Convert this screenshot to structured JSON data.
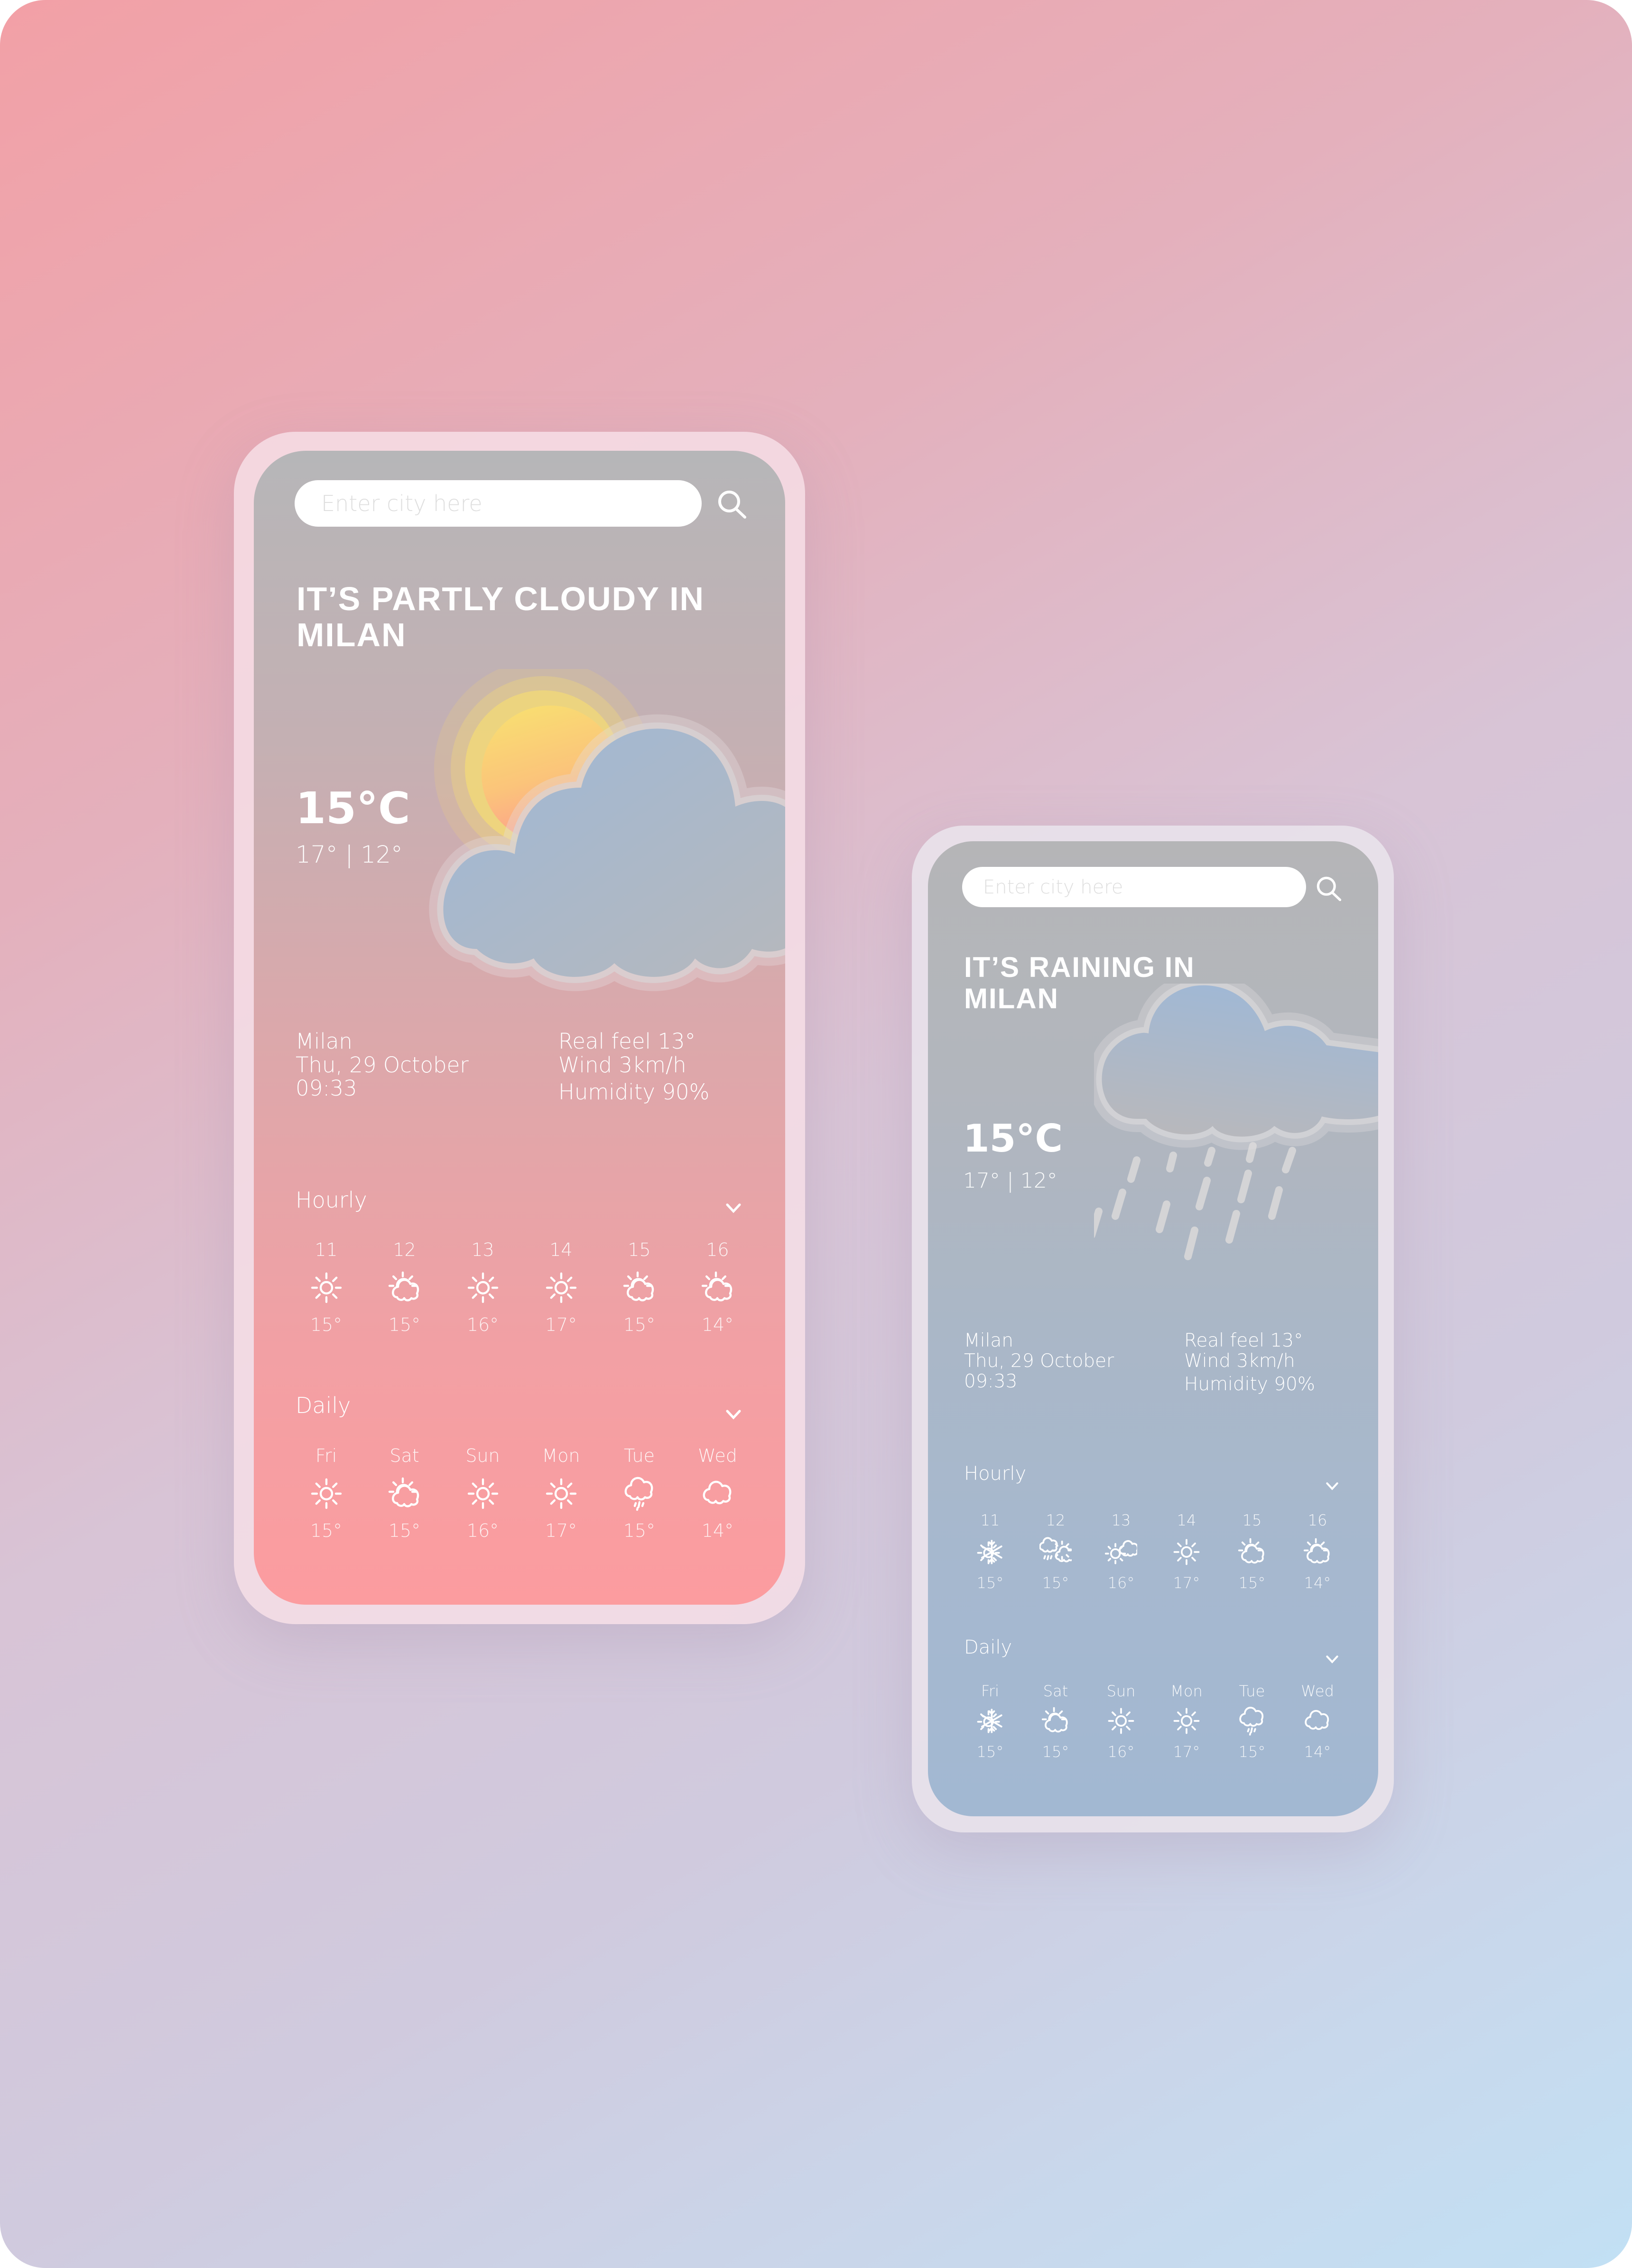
{
  "colors": {
    "background_start": "#f2a0a6",
    "background_end": "#c2e0f4",
    "phone1_screen_top": "#b6b6b8",
    "phone1_screen_bottom": "#fc9c9f",
    "phone2_screen_top": "#b5b5b7",
    "phone2_screen_bottom": "#a2b8d2",
    "text": "#ffffff",
    "cloud": "#a3b8d0",
    "sun": "#f8d870"
  },
  "phones": [
    {
      "id": "partly-cloudy",
      "search": {
        "placeholder": "Enter city here",
        "value": "",
        "icon": "search-icon"
      },
      "headline": {
        "line1": "IT’S PARTLY CLOUDY IN",
        "line2": "MILAN"
      },
      "illustration": "partly-cloudy-illustration",
      "current": {
        "temp": "15°C",
        "hi_lo": "17° | 12°"
      },
      "location": {
        "city": "Milan",
        "date": "Thu, 29 October",
        "time": "09:33"
      },
      "details": {
        "real_feel": "Real feel 13°",
        "wind": "Wind 3km/h",
        "humidity": "Humidity 90%"
      },
      "hourly": {
        "label": "Hourly",
        "items": [
          {
            "label": "11",
            "icon": "sun-icon",
            "temp": "15°"
          },
          {
            "label": "12",
            "icon": "partly-cloudy-icon",
            "temp": "15°"
          },
          {
            "label": "13",
            "icon": "sun-icon",
            "temp": "16°"
          },
          {
            "label": "14",
            "icon": "sun-icon",
            "temp": "17°"
          },
          {
            "label": "15",
            "icon": "partly-cloudy-icon",
            "temp": "15°"
          },
          {
            "label": "16",
            "icon": "partly-cloudy-icon",
            "temp": "14°"
          }
        ]
      },
      "daily": {
        "label": "Daily",
        "items": [
          {
            "label": "Fri",
            "icon": "sun-icon",
            "temp": "15°"
          },
          {
            "label": "Sat",
            "icon": "partly-cloudy-icon",
            "temp": "15°"
          },
          {
            "label": "Sun",
            "icon": "sun-icon",
            "temp": "16°"
          },
          {
            "label": "Mon",
            "icon": "sun-icon",
            "temp": "17°"
          },
          {
            "label": "Tue",
            "icon": "rain-icon",
            "temp": "15°"
          },
          {
            "label": "Wed",
            "icon": "cloud-icon",
            "temp": "14°"
          }
        ]
      }
    },
    {
      "id": "raining",
      "search": {
        "placeholder": "Enter city here",
        "value": "",
        "icon": "search-icon"
      },
      "headline": {
        "line1": "IT’S RAINING IN",
        "line2": "MILAN"
      },
      "illustration": "rain-cloud-illustration",
      "current": {
        "temp": "15°C",
        "hi_lo": "17° | 12°"
      },
      "location": {
        "city": "Milan",
        "date": "Thu, 29 October",
        "time": "09:33"
      },
      "details": {
        "real_feel": "Real feel 13°",
        "wind": "Wind 3km/h",
        "humidity": "Humidity 90%"
      },
      "hourly": {
        "label": "Hourly",
        "items": [
          {
            "label": "11",
            "icon": "snow-sun-icon",
            "temp": "15°"
          },
          {
            "label": "12",
            "icon": "rain-partly-cloudy-icon",
            "temp": "15°"
          },
          {
            "label": "13",
            "icon": "sun-cloud-icon",
            "temp": "16°"
          },
          {
            "label": "14",
            "icon": "sun-icon",
            "temp": "17°"
          },
          {
            "label": "15",
            "icon": "partly-cloudy-icon",
            "temp": "15°"
          },
          {
            "label": "16",
            "icon": "partly-cloudy-icon",
            "temp": "14°"
          }
        ]
      },
      "daily": {
        "label": "Daily",
        "items": [
          {
            "label": "Fri",
            "icon": "snow-sun-icon",
            "temp": "15°"
          },
          {
            "label": "Sat",
            "icon": "partly-cloudy-icon",
            "temp": "15°"
          },
          {
            "label": "Sun",
            "icon": "sun-icon",
            "temp": "16°"
          },
          {
            "label": "Mon",
            "icon": "sun-icon",
            "temp": "17°"
          },
          {
            "label": "Tue",
            "icon": "rain-icon",
            "temp": "15°"
          },
          {
            "label": "Wed",
            "icon": "cloud-icon",
            "temp": "14°"
          }
        ]
      }
    }
  ]
}
